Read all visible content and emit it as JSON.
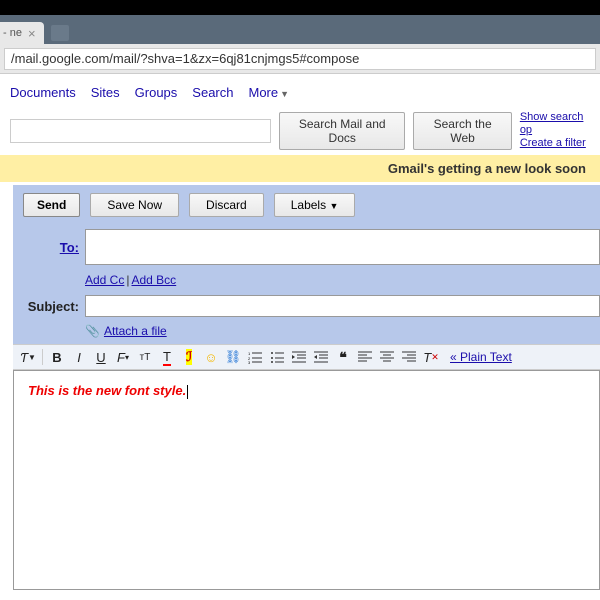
{
  "tab": {
    "title": "- ne",
    "close": "×"
  },
  "url": "/mail.google.com/mail/?shva=1&zx=6qj81cnjmgs5#compose",
  "nav": {
    "documents": "Documents",
    "sites": "Sites",
    "groups": "Groups",
    "search": "Search",
    "more": "More"
  },
  "searchbtns": {
    "maildocs": "Search Mail and Docs",
    "web": "Search the Web"
  },
  "rightlinks": {
    "show": "Show search op",
    "filter": "Create a filter"
  },
  "banner": "Gmail's getting a new look soon",
  "buttons": {
    "send": "Send",
    "savenow": "Save Now",
    "discard": "Discard",
    "labels": "Labels"
  },
  "fields": {
    "to": "To:",
    "subject": "Subject:",
    "addcc": "Add Cc",
    "addbcc": "Add Bcc",
    "attach": "Attach a file"
  },
  "plaintext": "« Plain Text",
  "body": "This is the new font style."
}
